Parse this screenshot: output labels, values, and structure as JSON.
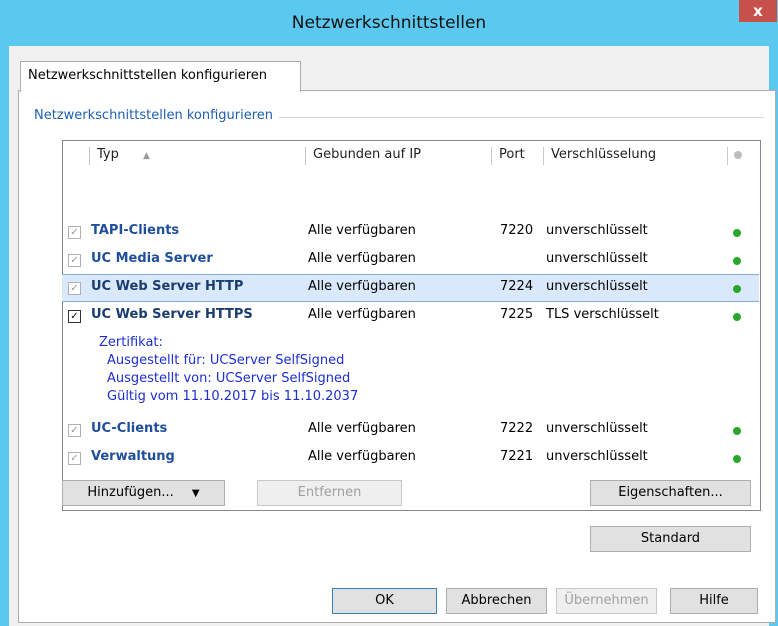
{
  "window": {
    "title": "Netzwerkschnittstellen",
    "close_label": "x"
  },
  "tab": {
    "label": "Netzwerkschnittstellen konfigurieren"
  },
  "group": {
    "label": "Netzwerkschnittstellen konfigurieren"
  },
  "columns": {
    "typ": "Typ",
    "ip": "Gebunden auf IP",
    "port": "Port",
    "enc": "Verschlüsselung"
  },
  "rows": [
    {
      "typ": "TAPI-Clients",
      "ip": "Alle verfügbaren",
      "port": "7220",
      "enc": "unverschlüsselt",
      "checked": true,
      "status": "green"
    },
    {
      "typ": "UC Media Server",
      "ip": "Alle verfügbaren",
      "port": "",
      "enc": "unverschlüsselt",
      "checked": true,
      "status": "green"
    },
    {
      "typ": "UC Web Server HTTP",
      "ip": "Alle verfügbaren",
      "port": "7224",
      "enc": "unverschlüsselt",
      "checked": true,
      "status": "green",
      "selected": true
    },
    {
      "typ": "UC Web Server HTTPS",
      "ip": "Alle verfügbaren",
      "port": "7225",
      "enc": "TLS verschlüsselt",
      "checked": true,
      "status": "green"
    },
    {
      "typ": "UC-Clients",
      "ip": "Alle verfügbaren",
      "port": "7222",
      "enc": "unverschlüsselt",
      "checked": true,
      "status": "green"
    },
    {
      "typ": "Verwaltung",
      "ip": "Alle verfügbaren",
      "port": "7221",
      "enc": "unverschlüsselt",
      "checked": true,
      "status": "green"
    }
  ],
  "certificate": {
    "title": "Zertifikat:",
    "issued_to": "Ausgestellt für: UCServer SelfSigned",
    "issued_by": "Ausgestellt von: UCServer SelfSigned",
    "validity": "Gültig vom 11.10.2017 bis 11.10.2037"
  },
  "buttons": {
    "add": "Hinzufügen...",
    "remove": "Entfernen",
    "properties": "Eigenschaften...",
    "default": "Standard",
    "ok": "OK",
    "cancel": "Abbrechen",
    "apply": "Übernehmen",
    "help": "Hilfe"
  },
  "colors": {
    "accent": "#5bc8ef",
    "status_green": "#2aa62a",
    "close": "#c7504b",
    "link_blue": "#1f4e9c"
  }
}
